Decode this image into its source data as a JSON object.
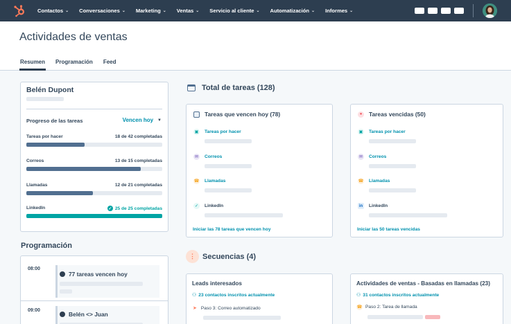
{
  "nav": {
    "items": [
      "Contactos",
      "Conversaciones",
      "Marketing",
      "Ventas",
      "Servicio al cliente",
      "Automatización",
      "Informes"
    ]
  },
  "page": {
    "title": "Actividades de ventas",
    "tabs": [
      "Resumen",
      "Programación",
      "Feed"
    ]
  },
  "profile": {
    "name": "Belén Dupont",
    "progress_title": "Progreso de las tareas",
    "filter_label": "Vencen hoy",
    "rows": [
      {
        "label": "Tareas por hacer",
        "count": "18 de 42 completadas",
        "fraction": 0.43
      },
      {
        "label": "Correos",
        "count": "13 de 15 completadas",
        "fraction": 0.84
      },
      {
        "label": "Llamadas",
        "count": "12 de 21 completadas",
        "fraction": 0.49
      },
      {
        "label": "LinkedIn",
        "count": "25 de 25 completadas",
        "fraction": 1.0
      }
    ]
  },
  "schedule": {
    "title": "Programación",
    "slots": [
      {
        "time": "08:00",
        "title": "77 tareas vencen hoy"
      },
      {
        "time": "09:00",
        "title": "Belén <> Juan"
      }
    ]
  },
  "tasks": {
    "title": "Total de tareas (128)",
    "due_today": {
      "title": "Tareas que vencen hoy (78)",
      "items": [
        "Tareas por hacer",
        "Correos",
        "Llamadas",
        "LinkedIn"
      ],
      "footer": "Iniciar las 78 tareas que vencen hoy"
    },
    "overdue": {
      "title": "Tareas vencidas (50)",
      "items": [
        "Tareas por hacer",
        "Correos",
        "Llamadas",
        "LinkedIn"
      ],
      "footer": "Iniciar las 50 tareas vencidas"
    }
  },
  "sequences": {
    "title": "Secuencias (4)",
    "cards": [
      {
        "title": "Leads interesados",
        "enrolled": "23 contactos inscritos actualmente",
        "step": "Paso 3: Correo automatizado"
      },
      {
        "title": "Actividades de ventas - Basadas en llamadas (23)",
        "enrolled": "31 contactos inscritos actualmente",
        "step": "Paso 2: Tarea de llamada"
      }
    ]
  },
  "colors": {
    "nav_bg": "#2d3e50",
    "brand_orange": "#ff7a59",
    "link": "#0091ae",
    "bar_fill": "#516f90",
    "bar_complete": "#00a4a4"
  }
}
